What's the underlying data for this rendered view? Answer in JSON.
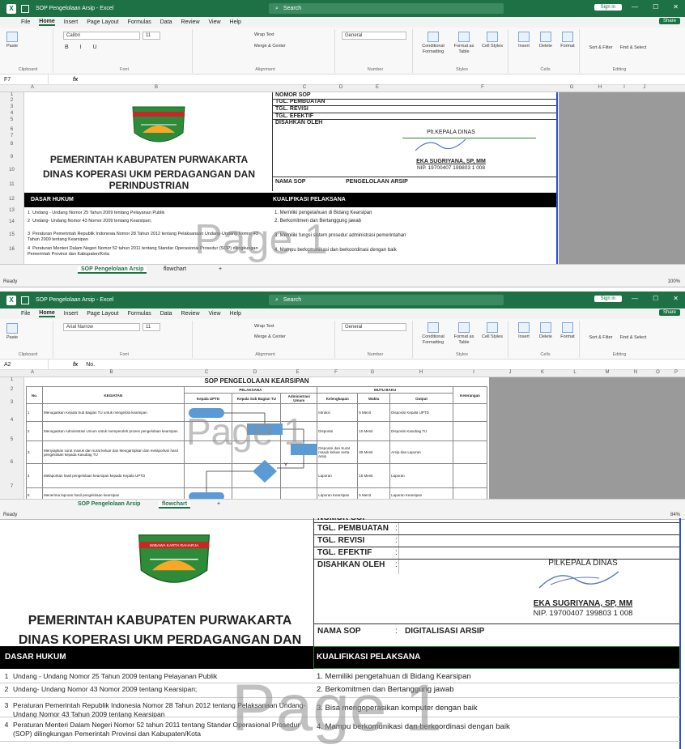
{
  "app": {
    "title1": "SOP Pengelolaan Arsip  -  Excel",
    "title2": "SOP Pengelolaan Arsip  -  Excel",
    "search": "Search",
    "signin": "Sign in",
    "share": "Share",
    "minimize": "—",
    "restore": "☐",
    "close": "✕"
  },
  "menu": [
    "File",
    "Home",
    "Insert",
    "Page Layout",
    "Formulas",
    "Data",
    "Review",
    "View",
    "Help"
  ],
  "ribbon": {
    "paste": "Paste",
    "clipboard": "Clipboard",
    "font_group": "Font",
    "font1": "Calibri",
    "font2": "Arial Narrow",
    "size": "11",
    "alignment": "Alignment",
    "wrap": "Wrap Text",
    "merge": "Merge & Center",
    "number_group": "Number",
    "number_fmt": "General",
    "styles": "Styles",
    "cond": "Conditional Formatting",
    "fmt_table": "Format as Table",
    "cell_styles": "Cell Styles",
    "cells": "Cells",
    "insert": "Insert",
    "delete": "Delete",
    "format": "Format",
    "editing": "Editing",
    "sort": "Sort & Filter",
    "find": "Find & Select"
  },
  "formula1": {
    "ref": "F7",
    "value": ""
  },
  "formula2": {
    "ref": "A2",
    "value": "No."
  },
  "cols1": [
    "A",
    "B",
    "C",
    "D",
    "E",
    "F",
    "G",
    "H",
    "I",
    "J",
    "K",
    "L",
    "M"
  ],
  "cols2": [
    "A",
    "B",
    "C",
    "D",
    "E",
    "F",
    "G",
    "H",
    "I",
    "J",
    "K",
    "L",
    "M",
    "N",
    "O",
    "P"
  ],
  "rows1": [
    "1",
    "2",
    "3",
    "4",
    "5",
    "6",
    "7",
    "8",
    "9",
    "10",
    "11",
    "12",
    "13",
    "14",
    "15",
    "16"
  ],
  "rows2": [
    "1",
    "2",
    "3",
    "4",
    "5",
    "6",
    "7"
  ],
  "doc": {
    "gov": "PEMERINTAH KABUPATEN PURWAKARTA",
    "dinas1": "DINAS KOPERASI UKM PERDAGANGAN DAN",
    "dinas2": "PERINDUSTRIAN",
    "logo_text": "WIBAWA KARTA RAHARJA",
    "nomor": "NOMOR SOP",
    "tgl_buat": "TGL. PEMBUATAN",
    "tgl_revisi": "TGL. REVISI",
    "tgl_efektif": "TGL. EFEKTIF",
    "disahkan": "DISAHKAN OLEH",
    "plt": "Plt.KEPALA DINAS",
    "nama_pejabat": "EKA SUGRIYANA, SP, MM",
    "nip": "NIP. 19700407 199803 1 008",
    "nama_sop": "NAMA SOP",
    "sop_value1": "PENGELOLAAN ARSIP",
    "sop_value2": "DIGITALISASI ARSIP",
    "colon": ":",
    "dasar": "DASAR HUKUM",
    "kualifikasi": "KUALIFIKASI PELAKSANA",
    "dasar_items": [
      {
        "n": "1",
        "t": "Undang - Undang Nomor 25 Tahun 2009 tentang Pelayanan Publik"
      },
      {
        "n": "2",
        "t": "Undang- Undang Nomor 43 Nomor 2009 tentang Kearsipan;"
      },
      {
        "n": "3",
        "t": "Peraturan Pemerintah Republik Indonesia Nomor 28 Tahun 2012 tentang Pelaksanaan Undang-Undang Nomor 43 Tahun 2009 tentang Kearsipan"
      },
      {
        "n": "4",
        "t": "Peraturan Menteri Dalam Negeri Nomor 52 tahun 2011 tentang Standar Operasional Prosedur (SOP) dilingkungan Pemerintah Provinsi dan Kabupaten/Kota"
      }
    ],
    "kual_items1": [
      "1. Memiliki pengetahuan di Bidang Kearsipan",
      "2. Berkomitmen dan Bertanggung jawab",
      "3. Memiliki fungsi sistem prosedur administrasi pemerintahan",
      "4. Mampu berkomunikasi dan berkoordinasi dengan baik"
    ],
    "kual_items3": [
      "1. Memiliki pengetahuan di Bidang Kearsipan",
      "2. Berkomitmen dan Bertanggung jawab",
      "3. Bisa mengoperasikan komputer dengan baik",
      "4. Mampu berkomunikasi dan berkoordinasi dengan baik"
    ],
    "watermark": "Page 1"
  },
  "flow": {
    "title": "SOP PENGELOLAAN KEARSIPAN",
    "h_no": "No.",
    "h_kegiatan": "KEGIATAN",
    "h_pelaksana": "PELAKSANA",
    "h_mutu": "MUTU BAKU",
    "h_ket": "Keterangan",
    "h_kepala": "Kepala UPTD",
    "h_kasubag": "Kepala Sub Bagian TU",
    "h_admin": "Administrasi Umum",
    "h_kelengkapan": "Kelengkapan",
    "h_waktu": "Waktu",
    "h_output": "Output",
    "decision": "Y",
    "rows": [
      {
        "no": "1",
        "keg": "Menugaskan Kepala Sub Bagian TU untuk mengelola kearsipan",
        "kel": "Intruksi",
        "w": "5 Menit",
        "out": "Disposisi Kepala UPTD"
      },
      {
        "no": "2",
        "keg": "Menugaskan Administrasi Umum untuk memperoleh proses pengelolaan kearsipan",
        "kel": "Disposisi",
        "w": "10 Menit",
        "out": "Disposisi Kasubag TU"
      },
      {
        "no": "3",
        "keg": "Menyiapkan surat masuk dan surat keluar dan Mengarsipkan dan melaporkan hasil pengelolaan kepada Kasubag TU",
        "kel": "Disposisi dan Surat masuk keluar serta arsip",
        "w": "30 Menit",
        "out": "Arsip dan Laporan"
      },
      {
        "no": "4",
        "keg": "Melaporkan hasil pengelolaan kearsipan kepada Kepala UPTD",
        "kel": "Laporan",
        "w": "15 Menit",
        "out": "Laporan"
      },
      {
        "no": "5",
        "keg": "Menerima laporan hasil pengelolaan kearsipan",
        "kel": "Laporan Kearsipan",
        "w": "5 Menit",
        "out": "Laporan Kearsipan"
      }
    ]
  },
  "tabs": {
    "sop": "SOP Pengelolaan Arsip",
    "flow": "flowchart",
    "add": "+"
  },
  "status": {
    "ready": "Ready",
    "zoom1": "100%",
    "zoom2": "84%"
  },
  "colors": {
    "excel_green": "#1e7145",
    "grey": "#9a9a9a",
    "blue_shape": "#5b9bd5"
  }
}
